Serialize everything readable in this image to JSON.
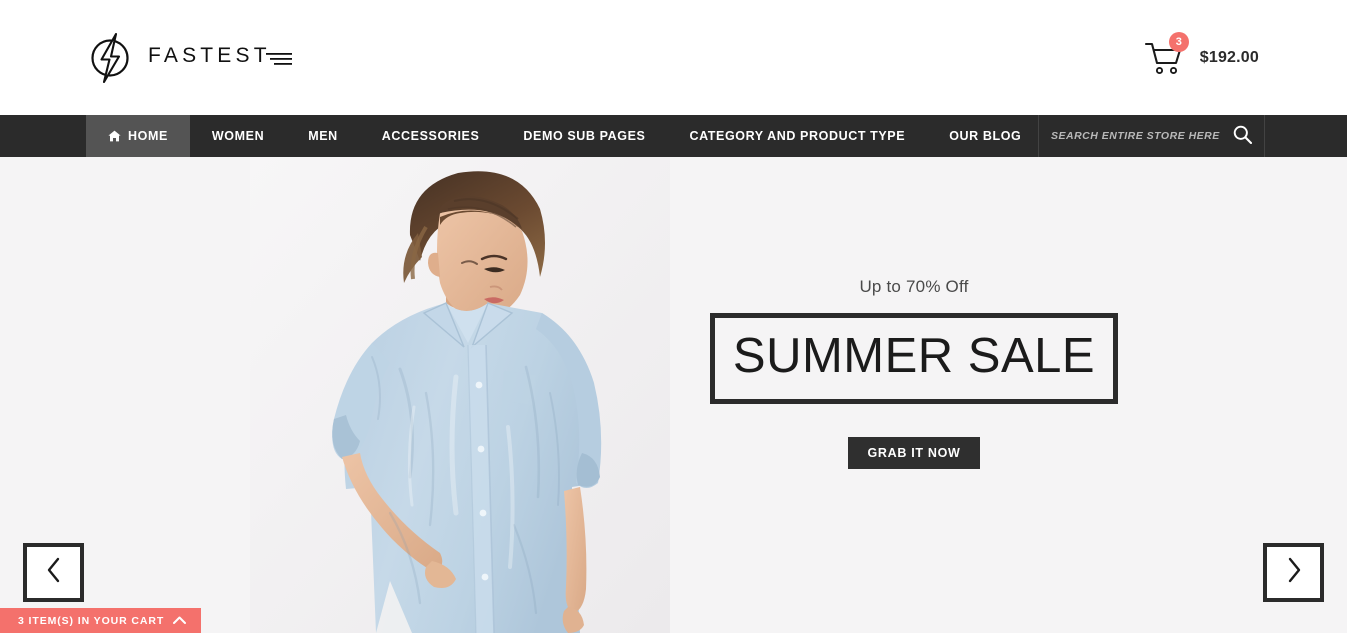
{
  "brand": {
    "name": "FASTEST",
    "logo_icon": "lightning-bolt-circle-icon"
  },
  "header": {
    "cart": {
      "icon": "shopping-cart-icon",
      "count": "3",
      "total": "$192.00"
    }
  },
  "nav": {
    "items": [
      {
        "label": "HOME",
        "active": true,
        "icon": "home-icon"
      },
      {
        "label": "WOMEN",
        "active": false
      },
      {
        "label": "MEN",
        "active": false
      },
      {
        "label": "ACCESSORIES",
        "active": false
      },
      {
        "label": "DEMO SUB PAGES",
        "active": false
      },
      {
        "label": "CATEGORY AND PRODUCT TYPE",
        "active": false
      },
      {
        "label": "OUR BLOG",
        "active": false
      }
    ]
  },
  "search": {
    "placeholder": "SEARCH ENTIRE STORE HERE...",
    "value": "",
    "icon": "search-icon"
  },
  "hero": {
    "eyebrow": "Up to 70% Off",
    "title": "SUMMER SALE",
    "cta_label": "GRAB IT NOW",
    "prev_icon": "chevron-left-icon",
    "next_icon": "chevron-right-icon",
    "background_color": "#f5f4f5",
    "image_alt": "Woman wearing light blue button-down shirt"
  },
  "cart_bar": {
    "label": "3 ITEM(S) IN YOUR CART",
    "chevron_icon": "chevron-up-icon",
    "color": "#f4716c"
  },
  "colors": {
    "nav_background": "#2b2b2b",
    "nav_active": "#545454",
    "accent": "#f4716c",
    "hero_background": "#f5f4f5",
    "text_dark": "#1b1b1b"
  }
}
